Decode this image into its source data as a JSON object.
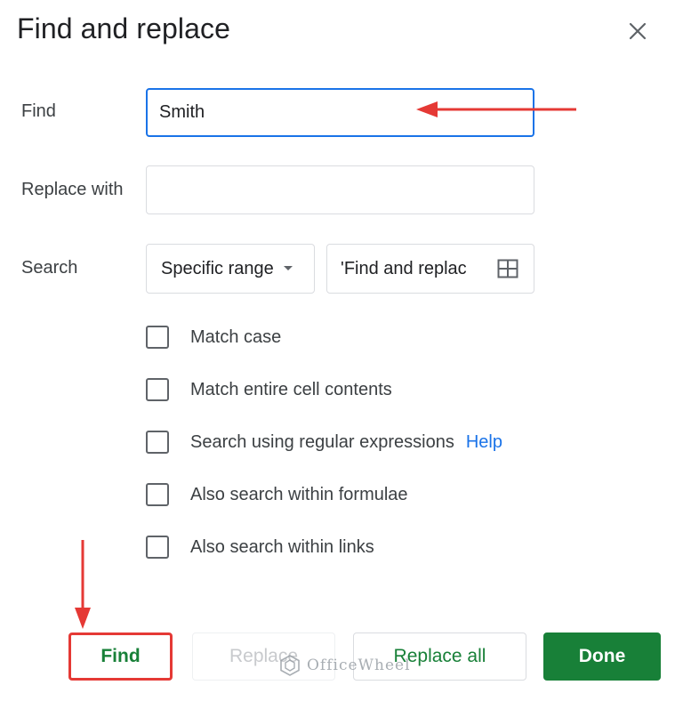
{
  "dialog": {
    "title": "Find and replace",
    "close_icon": "close-icon"
  },
  "find": {
    "label": "Find",
    "value": "Smith",
    "placeholder": ""
  },
  "replace": {
    "label": "Replace with",
    "value": "",
    "placeholder": ""
  },
  "search": {
    "label": "Search",
    "scope_selected": "Specific range",
    "range_value": "'Find and replac",
    "range_icon": "grid-icon"
  },
  "options": [
    {
      "label": "Match case",
      "checked": false
    },
    {
      "label": "Match entire cell contents",
      "checked": false
    },
    {
      "label": "Search using regular expressions",
      "checked": false
    },
    {
      "label": "Also search within formulae",
      "checked": false
    },
    {
      "label": "Also search within links",
      "checked": false
    }
  ],
  "help_link": "Help",
  "buttons": {
    "find": "Find",
    "replace": "Replace",
    "replace_all": "Replace all",
    "done": "Done"
  },
  "watermark": {
    "text": "OfficeWheel"
  },
  "colors": {
    "accent_blue": "#1a73e8",
    "google_green": "#188038",
    "annotation_red": "#e53935"
  }
}
